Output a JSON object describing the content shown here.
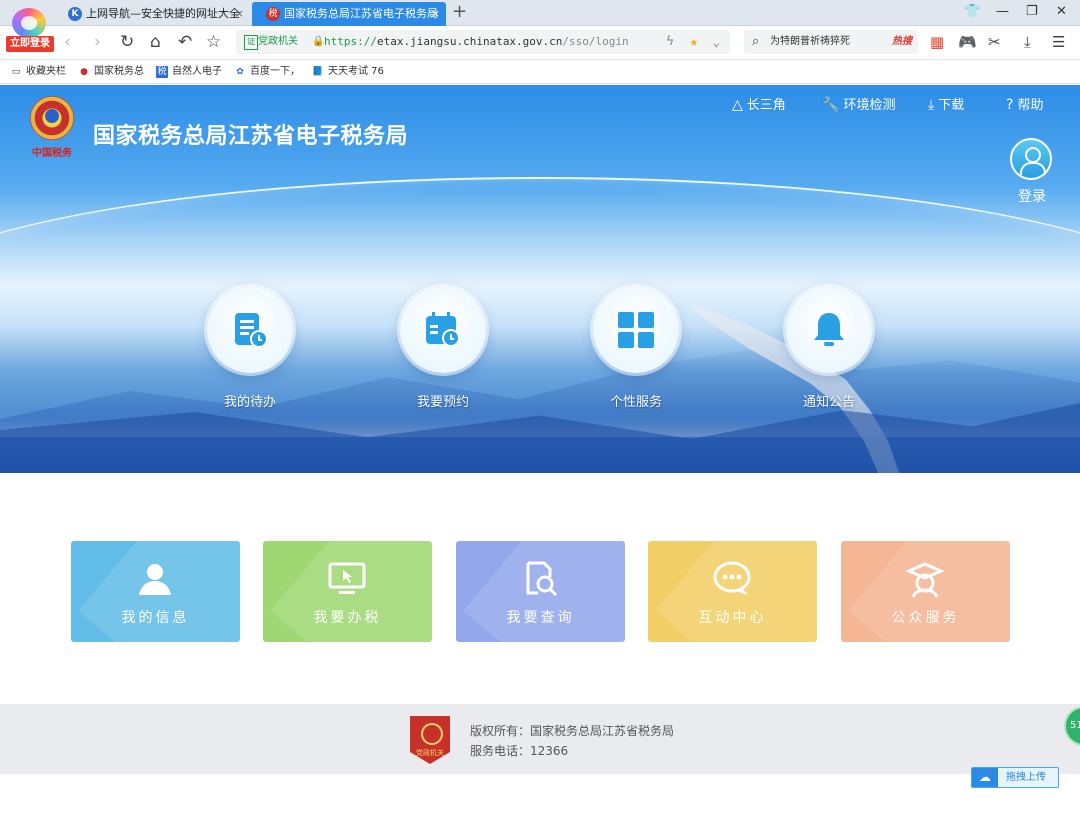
{
  "browser": {
    "brand_login": "立即登录",
    "tabs": [
      {
        "label": "上网导航—安全快捷的网址大全",
        "icon": "K"
      },
      {
        "label": "国家税务总局江苏省电子税务局",
        "icon": "税"
      }
    ],
    "url": {
      "cert_label": "党政机关",
      "scheme": "https://",
      "host": "etax.jiangsu.chinatax.gov.cn",
      "path": "/sso/login"
    },
    "search": {
      "text": "为特朗普祈祷猝死",
      "hot": "热搜"
    },
    "bookmarks": [
      "收藏夹栏",
      "国家税务总",
      "自然人电子",
      "百度一下，",
      "天天考试 76"
    ]
  },
  "header": {
    "title": "国家税务总局江苏省电子税务局",
    "emblem_sub": "中国税务",
    "links": [
      {
        "label": "长三角",
        "icon": "△"
      },
      {
        "label": "环境检测",
        "icon": "🔧"
      },
      {
        "label": "下载",
        "icon": "⤓"
      },
      {
        "label": "帮助",
        "icon": "?"
      }
    ],
    "login_label": "登录"
  },
  "features": [
    {
      "label": "我的待办",
      "icon": "todo-icon"
    },
    {
      "label": "我要预约",
      "icon": "calendar-icon"
    },
    {
      "label": "个性服务",
      "icon": "grid-icon"
    },
    {
      "label": "通知公告",
      "icon": "bell-icon"
    }
  ],
  "cards": [
    {
      "label": "我的信息",
      "color": "#62bde8",
      "icon": "user-icon"
    },
    {
      "label": "我要办税",
      "color": "#9fd872",
      "icon": "monitor-icon"
    },
    {
      "label": "我要查询",
      "color": "#93a8ec",
      "icon": "search-doc-icon"
    },
    {
      "label": "互动中心",
      "color": "#f2cf66",
      "icon": "chat-icon"
    },
    {
      "label": "公众服务",
      "color": "#f4b694",
      "icon": "graduate-icon"
    }
  ],
  "footer": {
    "copyright": "版权所有：国家税务总局江苏省税务局",
    "phone": "服务电话：12366",
    "badge_text": "党政机关"
  },
  "side_badge": "51",
  "upload_label": "拖拽上传"
}
